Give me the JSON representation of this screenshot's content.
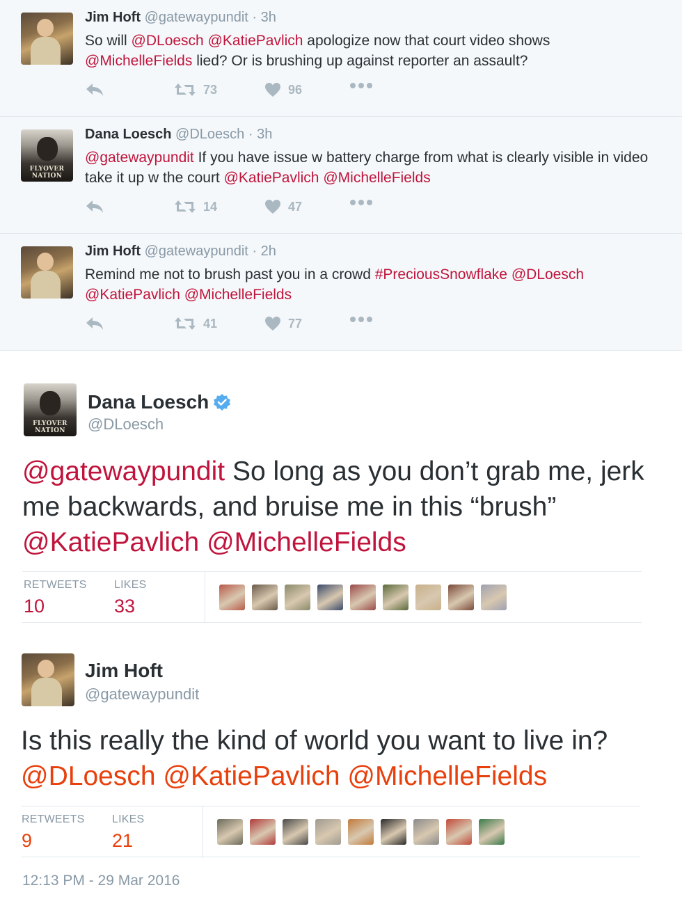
{
  "thread": [
    {
      "name": "Jim Hoft",
      "handle": "@gatewaypundit",
      "dot": "·",
      "time": "3h",
      "avatar": "jim",
      "text_parts": [
        {
          "t": "So will ",
          "kind": "text"
        },
        {
          "t": "@DLoesch",
          "kind": "mention"
        },
        {
          "t": " ",
          "kind": "text"
        },
        {
          "t": "@KatiePavlich",
          "kind": "mention"
        },
        {
          "t": " apologize now that court video shows ",
          "kind": "text"
        },
        {
          "t": "@MichelleFields",
          "kind": "mention"
        },
        {
          "t": " lied? Or is brushing up against reporter an assault?",
          "kind": "text"
        }
      ],
      "retweets": "73",
      "likes": "96"
    },
    {
      "name": "Dana Loesch",
      "handle": "@DLoesch",
      "dot": "·",
      "time": "3h",
      "avatar": "dana",
      "text_parts": [
        {
          "t": "@gatewaypundit",
          "kind": "mention"
        },
        {
          "t": " If you have issue w battery charge from what is clearly visible in video take it up w the court ",
          "kind": "text"
        },
        {
          "t": "@KatiePavlich",
          "kind": "mention"
        },
        {
          "t": " ",
          "kind": "text"
        },
        {
          "t": "@MichelleFields",
          "kind": "mention"
        }
      ],
      "retweets": "14",
      "likes": "47"
    },
    {
      "name": "Jim Hoft",
      "handle": "@gatewaypundit",
      "dot": "·",
      "time": "2h",
      "avatar": "jim",
      "text_parts": [
        {
          "t": "Remind me not to brush past you in a crowd ",
          "kind": "text"
        },
        {
          "t": "#PreciousSnowflake",
          "kind": "mention"
        },
        {
          "t": " ",
          "kind": "text"
        },
        {
          "t": "@DLoesch",
          "kind": "mention"
        },
        {
          "t": " ",
          "kind": "text"
        },
        {
          "t": "@KatiePavlich",
          "kind": "mention"
        },
        {
          "t": " ",
          "kind": "text"
        },
        {
          "t": "@MichelleFields",
          "kind": "mention"
        }
      ],
      "retweets": "41",
      "likes": "77"
    }
  ],
  "dana_tweet": {
    "name": "Dana Loesch",
    "handle": "@DLoesch",
    "verified": true,
    "text_parts": [
      {
        "t": "@gatewaypundit",
        "kind": "mention"
      },
      {
        "t": " So long as you don’t grab me, jerk me backwards, and bruise me in this “brush” ",
        "kind": "text"
      },
      {
        "t": "@KatiePavlich",
        "kind": "mention"
      },
      {
        "t": " ",
        "kind": "text"
      },
      {
        "t": "@MichelleFields",
        "kind": "mention"
      }
    ],
    "retweets_label": "RETWEETS",
    "retweets": "10",
    "likes_label": "LIKES",
    "likes": "33",
    "likers": [
      "#b85a4a",
      "#6a5a4a",
      "#8a8a6a",
      "#3a4a6a",
      "#9a4a4a",
      "#5a6a3a",
      "#c8b08a",
      "#7a4a3a",
      "#a0a0b0"
    ]
  },
  "jim_tweet": {
    "name": "Jim Hoft",
    "handle": "@gatewaypundit",
    "text_parts": [
      {
        "t": "Is this really the kind of world you want to live in?",
        "kind": "text"
      },
      {
        "t": "@DLoesch",
        "kind": "mention"
      },
      {
        "t": " ",
        "kind": "text"
      },
      {
        "t": "@KatiePavlich",
        "kind": "mention"
      },
      {
        "t": " ",
        "kind": "text"
      },
      {
        "t": "@MichelleFields",
        "kind": "mention"
      }
    ],
    "retweets_label": "RETWEETS",
    "retweets": "9",
    "likes_label": "LIKES",
    "likes": "21",
    "likers": [
      "#6a6a5a",
      "#b03a3a",
      "#4a4a4a",
      "#a09a90",
      "#c07a3a",
      "#2a2a2a",
      "#8a8a8a",
      "#c04a3a",
      "#3a7a4a"
    ],
    "timestamp": "12:13 PM - 29 Mar 2016"
  },
  "colors": {
    "mention_red": "#c0143c",
    "mention_orange": "#e8400c",
    "muted": "#8899a6",
    "verified": "#55acee"
  }
}
